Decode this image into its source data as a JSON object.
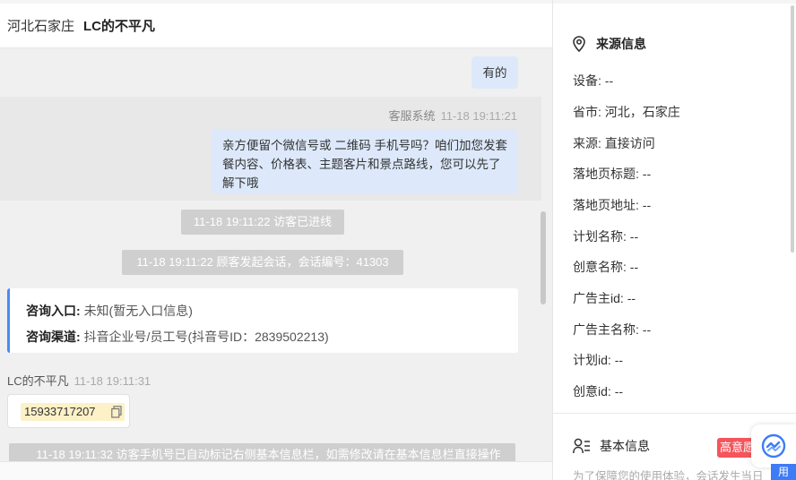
{
  "chat": {
    "header": {
      "location": "河北石家庄",
      "name": "LC的不平凡"
    },
    "messages": {
      "reply_1": "有的",
      "system_sender": "客服系统",
      "system_time": "11-18 19:11:21",
      "system_text": "亲方便留个微信号或 二维码 手机号吗？咱们加您发套餐内容、价格表、主题客片和景点路线，您可以先了解下哦",
      "event_1": "11-18 19:11:22 访客已进线",
      "event_2": "11-18 19:11:22 顾客发起会话，会话编号：41303",
      "source_card": {
        "entry_label": "咨询入口:",
        "entry_value": "未知(暂无入口信息)",
        "channel_label": "咨询渠道:",
        "channel_value": "抖音企业号/员工号(抖音号ID：2839502213)"
      },
      "visitor_name": "LC的不平凡",
      "visitor_time": "11-18 19:11:31",
      "visitor_phone": "15933717207",
      "event_3": "11-18 19:11:32 访客手机号已自动标记右侧基本信息栏，如需修改请在基本信息栏直接操作"
    }
  },
  "info": {
    "source_title": "来源信息",
    "fields": [
      {
        "label": "设备:",
        "value": "--"
      },
      {
        "label": "省市:",
        "value": "河北，石家庄"
      },
      {
        "label": "来源:",
        "value": "直接访问"
      },
      {
        "label": "落地页标题:",
        "value": "--"
      },
      {
        "label": "落地页地址:",
        "value": "--"
      },
      {
        "label": "计划名称:",
        "value": "--"
      },
      {
        "label": "创意名称:",
        "value": "--"
      },
      {
        "label": "广告主id:",
        "value": "--"
      },
      {
        "label": "广告主名称:",
        "value": "--"
      },
      {
        "label": "计划id:",
        "value": "--"
      },
      {
        "label": "创意id:",
        "value": "--"
      }
    ],
    "basic_title": "基本信息",
    "intent_badge": "高意愿",
    "basic_hint": "为了保障您的使用体验，会话发生当日",
    "float_tag": "用"
  }
}
